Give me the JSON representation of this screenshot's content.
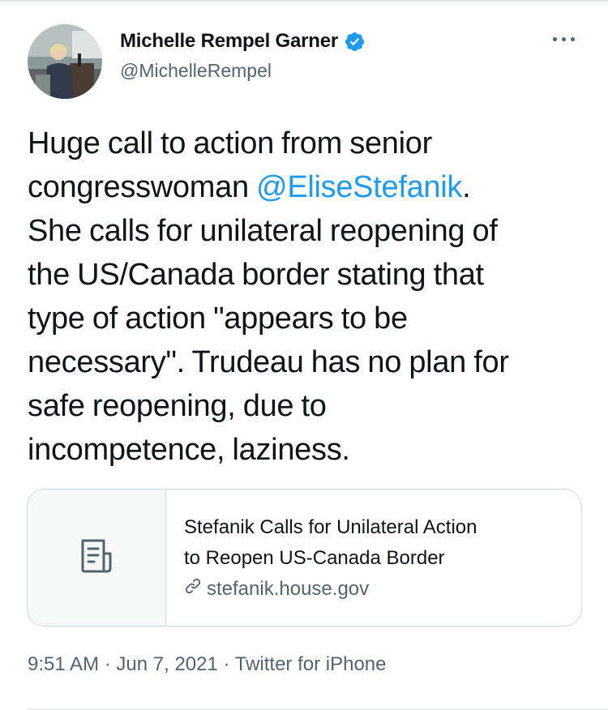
{
  "author": {
    "name": "Michelle Rempel Garner",
    "handle": "@MichelleRempel",
    "verified": true,
    "avatar_icon": "profile-photo"
  },
  "tweet": {
    "lines": [
      {
        "before": "Huge call to action from senior",
        "mention": "",
        "after": ""
      },
      {
        "before": "congresswoman ",
        "mention": "@EliseStefanik",
        "after": "."
      },
      {
        "before": "She calls for unilateral reopening of",
        "mention": "",
        "after": ""
      },
      {
        "before": "the US/Canada border stating that",
        "mention": "",
        "after": ""
      },
      {
        "before": "type of action \"appears to be",
        "mention": "",
        "after": ""
      },
      {
        "before": "necessary\". Trudeau has no plan for",
        "mention": "",
        "after": ""
      },
      {
        "before": "safe reopening, due to",
        "mention": "",
        "after": ""
      },
      {
        "before": "incompetence, laziness.",
        "mention": "",
        "after": ""
      }
    ]
  },
  "link_card": {
    "title_line1": "Stefanik Calls for Unilateral Action",
    "title_line2": "to Reopen US-Canada Border",
    "domain": "stefanik.house.gov",
    "thumb_icon": "document-icon",
    "link_icon": "link-icon"
  },
  "meta": {
    "time": "9:51 AM",
    "sep1": " · ",
    "date": "Jun 7, 2021",
    "sep2": " · ",
    "source": "Twitter for iPhone"
  },
  "colors": {
    "accent": "#1d9bf0",
    "text": "#0f1419",
    "secondary": "#536471",
    "border": "#cfd9de"
  }
}
